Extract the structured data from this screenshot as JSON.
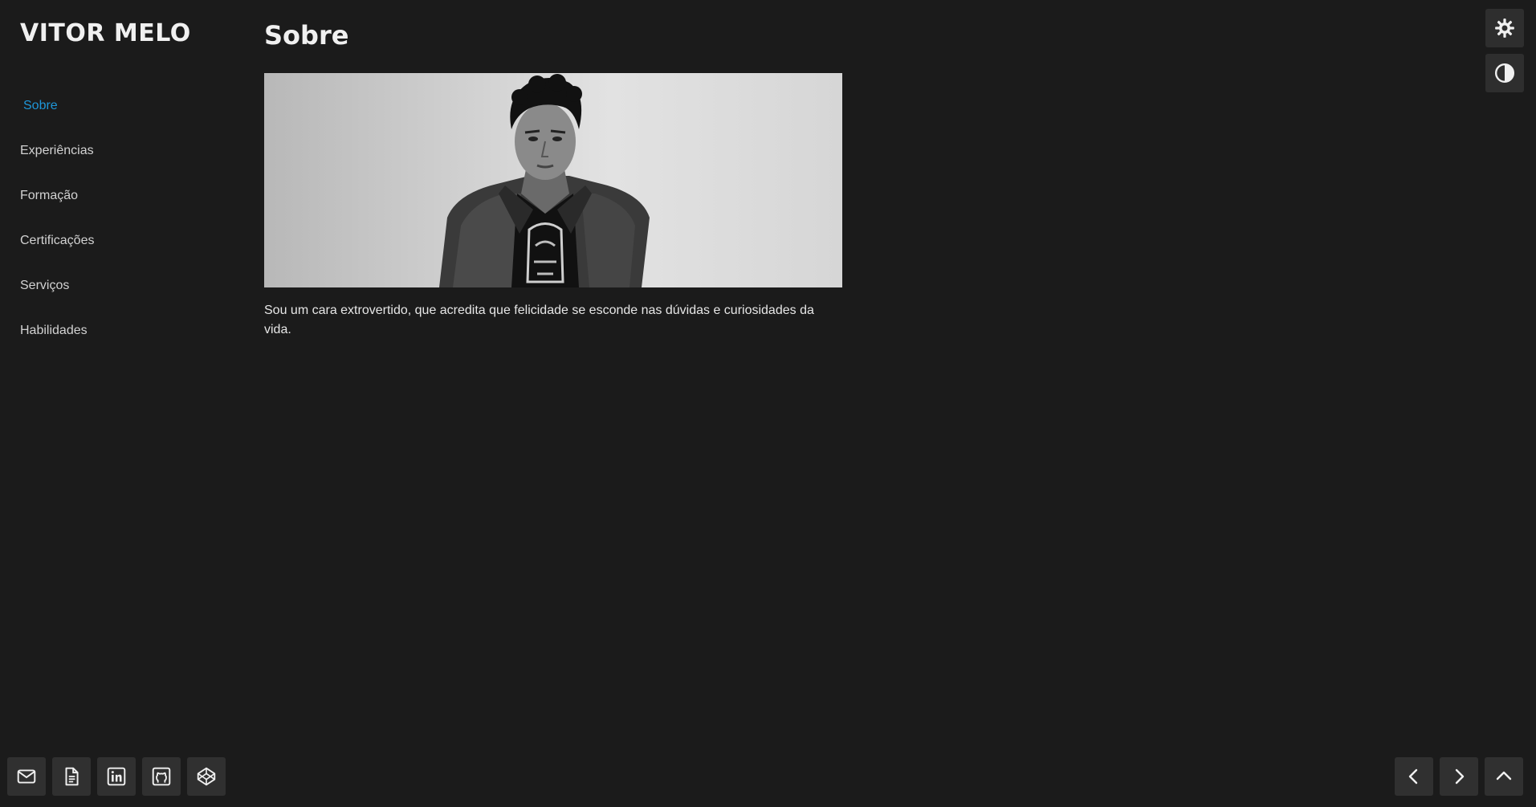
{
  "brand": "VITOR MELO",
  "nav": {
    "items": [
      {
        "label": "Sobre",
        "active": true
      },
      {
        "label": "Experiências"
      },
      {
        "label": "Formação"
      },
      {
        "label": "Certificações"
      },
      {
        "label": "Serviços"
      },
      {
        "label": "Habilidades"
      }
    ]
  },
  "main": {
    "title": "Sobre",
    "about": "Sou um cara extrovertido, que acredita que felicidade se esconde nas dúvidas e curiosidades da vida."
  },
  "toolbar": {
    "icons": [
      "gear-icon",
      "contrast-icon"
    ]
  },
  "social": {
    "icons": [
      "mail-icon",
      "document-icon",
      "linkedin-icon",
      "github-icon",
      "codepen-icon"
    ]
  },
  "pager": {
    "icons": [
      "chevron-left-icon",
      "chevron-right-icon",
      "chevron-up-icon"
    ]
  },
  "colors": {
    "background": "#1b1b1b",
    "accent": "#1e96d8",
    "button": "#303030"
  }
}
